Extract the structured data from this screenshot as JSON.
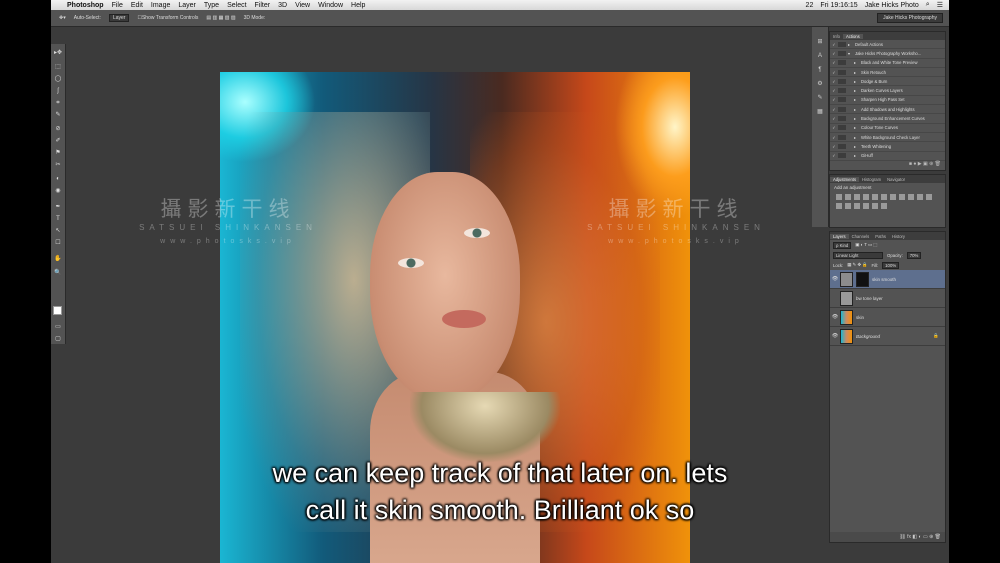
{
  "menubar": {
    "apple": "",
    "app": "Photoshop",
    "menus": [
      "File",
      "Edit",
      "Image",
      "Layer",
      "Type",
      "Select",
      "Filter",
      "3D",
      "View",
      "Window",
      "Help"
    ],
    "status_num": "22",
    "clock": "Fri 19:16:15",
    "user": "Jake Hicks Photo"
  },
  "options": {
    "auto_select": "Auto-Select:",
    "auto_select_value": "Layer",
    "show_transform": "Show Transform Controls",
    "mode_3d": "3D Mode:",
    "workspace": "Jake Hicks Photography"
  },
  "toolbar": {
    "tools": [
      "▸✥",
      "⬚",
      "◯",
      "ʃ",
      "⌗",
      "✎",
      "⊘",
      "✐",
      "⚑",
      "✂",
      "◐",
      "◉",
      "✒",
      "T",
      "↖",
      "☐",
      "✋",
      "🔍"
    ]
  },
  "watermark": {
    "cn": "攝影新干线",
    "en": "SATSUEI SHINKANSEN",
    "url": "www.photosks.vip"
  },
  "subtitle": {
    "line1": "we can keep track of that later on. lets",
    "line2": "call it skin smooth. Brilliant ok so"
  },
  "actions_panel": {
    "tabs": [
      "Info",
      "Actions"
    ],
    "items": [
      {
        "label": "Default Actions",
        "level": 0
      },
      {
        "label": "Jake Hicks Photography Worksho...",
        "level": 0
      },
      {
        "label": "Black and White Tone Preview",
        "level": 1
      },
      {
        "label": "Skin Retouch",
        "level": 1
      },
      {
        "label": "Dodge & Burn",
        "level": 1
      },
      {
        "label": "Darken Curves Layers",
        "level": 1
      },
      {
        "label": "Sharpen High Pass Set",
        "level": 1
      },
      {
        "label": "Add Shadows and Highlights",
        "level": 1
      },
      {
        "label": "Background Enhancement Curves",
        "level": 1
      },
      {
        "label": "Colour Tone Curves",
        "level": 1
      },
      {
        "label": "White Background Check Layer",
        "level": 1
      },
      {
        "label": "Teeth Whitening",
        "level": 1
      },
      {
        "label": "GiHuff",
        "level": 1
      }
    ]
  },
  "adjustments_panel": {
    "tabs": [
      "Adjustments",
      "Histogram",
      "Navigator"
    ],
    "heading": "Add an adjustment"
  },
  "layers_panel": {
    "tabs": [
      "Layers",
      "Channels",
      "Paths",
      "History"
    ],
    "kind": "ρ Kind",
    "blend_mode": "Linear Light",
    "opacity_label": "Opacity:",
    "opacity_value": "70%",
    "lock_label": "Lock:",
    "fill_label": "Fill:",
    "fill_value": "100%",
    "layers": [
      {
        "name": "skin smooth",
        "selected": true
      },
      {
        "name": "bw tone layer",
        "selected": false
      },
      {
        "name": "skin",
        "selected": false
      },
      {
        "name": "Background",
        "selected": false
      }
    ]
  },
  "colors": {
    "chrome": "#3b3b3b",
    "panel": "#535353",
    "selection": "#5e6f8e"
  }
}
